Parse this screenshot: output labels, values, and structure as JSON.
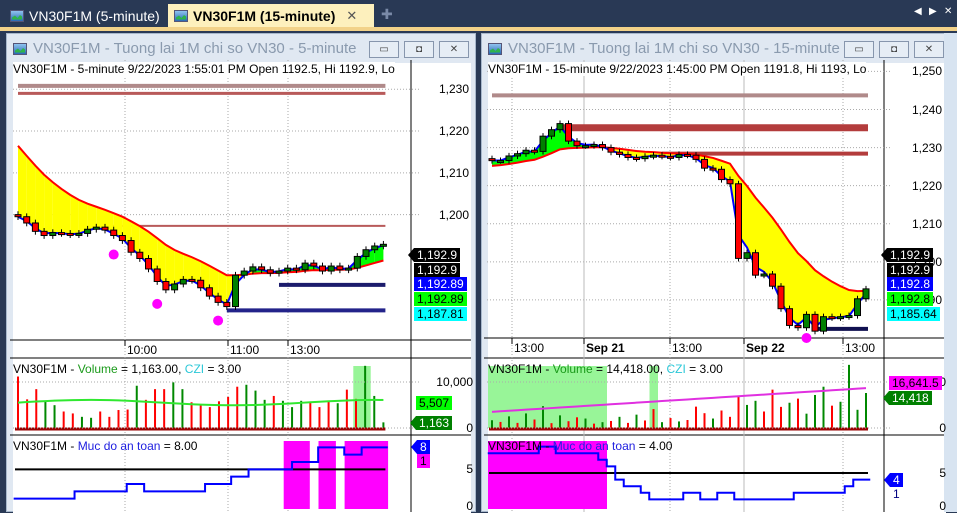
{
  "tabs": [
    {
      "label": "VN30F1M (5-minute)",
      "active": false
    },
    {
      "label": "VN30F1M (15-minute)",
      "active": true
    }
  ],
  "tab_close": "✕",
  "new_tab": "✚",
  "nav_left": "◀",
  "nav_right": "▶",
  "nav_close": "✕",
  "colors": {
    "up": "#008000",
    "down": "#ff0000",
    "ema_fast": "#0000ff",
    "ema_slow": "#ff0000",
    "bull_fill": "#00ff00",
    "bear_fill": "#ffff00",
    "marker": "#ff00ff",
    "safety_zone": "#ff00ff",
    "czi_zone": "#98f598"
  },
  "windows": [
    {
      "title": "VN30F1M - Tuong lai 1M chi so VN30 - 5-minute",
      "buttons": {
        "minimize": "▭",
        "restore": "◘",
        "close": "✕"
      },
      "legend": "VN30F1M - 5-minute 9/22/2023 1:55:01 PM Open 1192.5, Hi 1192.9, Lo",
      "price_ticks": [
        "1,230",
        "1,220",
        "1,210",
        "1,200"
      ],
      "time_labels": [
        "10:00",
        "11:00",
        "13:00"
      ],
      "price_labels": [
        {
          "text": "1,192.9",
          "bg": "#000000",
          "fg": "#ffffff",
          "arrow": true
        },
        {
          "text": "1,192.9",
          "bg": "#000000",
          "fg": "#ffffff"
        },
        {
          "text": "1,192.89",
          "bg": "#0000ff",
          "fg": "#ffffff"
        },
        {
          "text": "1,192.89",
          "bg": "#00ff00",
          "fg": "#000000"
        },
        {
          "text": "1,187.81",
          "bg": "#00ffff",
          "fg": "#000000"
        }
      ],
      "volume_legend": {
        "sym": "VN30F1M - ",
        "vol": "Volume",
        "eq": " = 1,163.00, ",
        "czi": "CZI",
        "eq2": " = 3.00"
      },
      "volume_ticks": [
        "10,000",
        "0"
      ],
      "volume_labels": [
        {
          "text": "5,507",
          "bg": "#00ff00",
          "fg": "#000000"
        },
        {
          "text": "1,163",
          "bg": "#008000",
          "fg": "#ffffff",
          "arrow": true
        }
      ],
      "safety_legend": {
        "sym": "VN30F1M - ",
        "name": "Muc do an toan",
        "eq": " = 8.00"
      },
      "safety_ticks": [
        "5",
        "0"
      ],
      "safety_labels": [
        {
          "text": "8",
          "bg": "#0000ff",
          "fg": "#ffffff",
          "arrow": true
        },
        {
          "text": "1",
          "bg": "#ff00ff",
          "fg": "#000000"
        }
      ]
    },
    {
      "title": "VN30F1M - Tuong lai 1M chi so VN30 - 15-minute",
      "buttons": {
        "minimize": "▭",
        "restore": "◘",
        "close": "✕"
      },
      "legend": "VN30F1M - 15-minute 9/22/2023 1:45:00 PM Open 1191.8, Hi 1193, Lo",
      "price_ticks": [
        "1,250",
        "1,240",
        "1,230",
        "1,220",
        "1,210",
        "1,200",
        "1,190"
      ],
      "time_labels": [
        "13:00",
        "Sep 21",
        "13:00",
        "Sep 22",
        "13:00"
      ],
      "price_labels": [
        {
          "text": "1,192.9",
          "bg": "#000000",
          "fg": "#ffffff",
          "arrow": true
        },
        {
          "text": "1,192.9",
          "bg": "#000000",
          "fg": "#ffffff"
        },
        {
          "text": "1,192.8",
          "bg": "#0000ff",
          "fg": "#ffffff"
        },
        {
          "text": "1,192.8",
          "bg": "#00ff00",
          "fg": "#000000"
        },
        {
          "text": "1,185.64",
          "bg": "#00ffff",
          "fg": "#000000"
        }
      ],
      "volume_legend": {
        "sym": "VN30F1M - ",
        "vol": "Volume",
        "eq": " = 14,418.00, ",
        "czi": "CZI",
        "eq2": " = 3.00"
      },
      "volume_ticks": [
        "10,000",
        "0"
      ],
      "volume_labels": [
        {
          "text": "16,641.5",
          "bg": "#ff00ff",
          "fg": "#000000"
        },
        {
          "text": "14,418",
          "bg": "#008000",
          "fg": "#ffffff",
          "arrow": true
        }
      ],
      "safety_legend": {
        "sym": "VN30F1M - ",
        "name": "Muc do an toan",
        "eq": " = 4.00"
      },
      "safety_ticks": [
        "5",
        "0"
      ],
      "safety_labels": [
        {
          "text": "4",
          "bg": "#0000ff",
          "fg": "#ffffff",
          "arrow": true
        },
        {
          "text": "1",
          "bg": "transparent",
          "fg": "#000080"
        }
      ]
    }
  ],
  "chart_data": [
    {
      "type": "candlestick",
      "title": "VN30F1M 5-minute",
      "ylim": [
        1170,
        1237
      ],
      "closes": [
        1199.5,
        1198,
        1196,
        1195,
        1195.7,
        1195.5,
        1195.2,
        1195.5,
        1196.5,
        1197,
        1196.3,
        1195,
        1193.8,
        1191,
        1189.5,
        1187,
        1184,
        1182,
        1183.4,
        1184.5,
        1184.3,
        1182.5,
        1180.5,
        1179,
        1178,
        1185.5,
        1186.5,
        1187.5,
        1186.8,
        1186,
        1186.5,
        1187.2,
        1186.8,
        1188.4,
        1187.7,
        1186.5,
        1187.7,
        1186.8,
        1187.2,
        1190,
        1191.6,
        1192.5,
        1192.9
      ],
      "ema_slow_start": 1219,
      "levels": [
        {
          "price": 1230.8,
          "color": "#b08a8a",
          "from": 0,
          "width": 4
        },
        {
          "price": 1229,
          "color": "#b85a5a",
          "from": 0,
          "width": 3
        },
        {
          "price": 1197.3,
          "color": "#b85a5a",
          "from": 10,
          "width": 2
        },
        {
          "price": 1183.2,
          "color": "#1c1c6c",
          "from": 30,
          "width": 4
        },
        {
          "price": 1177.1,
          "color": "#23238a",
          "from": 24,
          "width": 4
        }
      ],
      "markers": [
        11,
        16,
        23
      ],
      "volume": {
        "ylim": [
          0,
          14000
        ],
        "values": [
          10600,
          5900,
          8000,
          5400,
          4700,
          3400,
          3000,
          2300,
          2100,
          3400,
          2300,
          3700,
          3800,
          8700,
          5800,
          8000,
          8000,
          9400,
          8000,
          5300,
          4700,
          4300,
          5500,
          6400,
          8500,
          8900,
          7700,
          5800,
          6600,
          5600,
          4300,
          5600,
          5200,
          4300,
          5400,
          5100,
          7900,
          6000,
          12800,
          6600,
          1163
        ],
        "dirs": "rrrggrrggrrrrgrrrggrrrrrrgggrgggrrrgrrggg",
        "ma": 5507,
        "czi_ranges": [
          [
            39,
            40
          ]
        ]
      },
      "safety": {
        "ylim": [
          0,
          9
        ],
        "values": [
          1,
          1,
          1,
          1,
          1,
          1,
          1,
          2,
          2,
          2,
          2,
          2,
          2,
          3,
          3,
          2,
          2,
          2,
          2,
          2,
          2,
          2,
          3,
          3,
          3,
          4,
          4,
          5,
          5,
          5,
          5,
          5,
          6,
          6,
          6,
          8,
          8,
          8,
          7,
          7,
          8,
          8,
          8
        ],
        "threshold": 5,
        "zones": [
          [
            31,
            33
          ],
          [
            35,
            36
          ],
          [
            38,
            42
          ]
        ]
      }
    },
    {
      "type": "candlestick",
      "title": "VN30F1M 15-minute",
      "ylim": [
        1180,
        1253
      ],
      "closes": [
        1226.6,
        1226.6,
        1227.8,
        1228.4,
        1229.3,
        1229,
        1233,
        1234.7,
        1236.3,
        1231.7,
        1230.5,
        1230.5,
        1230.8,
        1230,
        1228.8,
        1228.2,
        1227.4,
        1227.1,
        1227.7,
        1228,
        1227.7,
        1227.4,
        1228.2,
        1228,
        1226.9,
        1224.6,
        1224.3,
        1221.6,
        1220.5,
        1200.9,
        1202.4,
        1196.5,
        1196.8,
        1193.6,
        1187.7,
        1183.3,
        1182.7,
        1186.2,
        1181.8,
        1185.6,
        1185.3,
        1185.6,
        1185.9,
        1190.3,
        1192.9
      ],
      "ema_slow_start": 1225,
      "levels": [
        {
          "price": 1243.7,
          "color": "#b08a8a",
          "from": 0,
          "width": 4
        },
        {
          "price": 1235.2,
          "color": "#b33c3c",
          "from": 8,
          "width": 7
        },
        {
          "price": 1228.4,
          "color": "#b33c3c",
          "from": 20,
          "width": 4
        },
        {
          "price": 1182.4,
          "color": "#101050",
          "from": 38,
          "width": 4
        }
      ],
      "markers": [
        37
      ],
      "volume": {
        "ylim": [
          0,
          28000
        ],
        "values": [
          3200,
          2500,
          4800,
          2100,
          6000,
          3500,
          9000,
          2000,
          5200,
          2800,
          4400,
          3900,
          1800,
          2400,
          2900,
          4600,
          2100,
          5500,
          3100,
          7800,
          2400,
          4100,
          2700,
          3300,
          8800,
          6100,
          3900,
          7200,
          4600,
          12800,
          9500,
          11200,
          6800,
          15800,
          8700,
          10400,
          12100,
          5900,
          13600,
          17000,
          9200,
          10800,
          26000,
          7500,
          14418
        ],
        "dirs": "grgrgrgrgrrgrgrgrgrrgrgrrrgrrrggrrrgrgggrgggg",
        "ma": 16641.5,
        "czi_ranges": [
          [
            0,
            13
          ],
          [
            19,
            19
          ]
        ]
      },
      "safety": {
        "ylim": [
          0,
          10
        ],
        "values": [
          8,
          8,
          8,
          8,
          8,
          8,
          9,
          9,
          8,
          8,
          8,
          8,
          8,
          7,
          6,
          4,
          3,
          3,
          2,
          1,
          1,
          1,
          1,
          2,
          2,
          1,
          1,
          2,
          2,
          1,
          1,
          1,
          1,
          1,
          1,
          1,
          2,
          2,
          2,
          2,
          2,
          2,
          3,
          4,
          4
        ],
        "threshold": 5,
        "zones": [
          [
            0,
            13
          ]
        ]
      }
    }
  ]
}
